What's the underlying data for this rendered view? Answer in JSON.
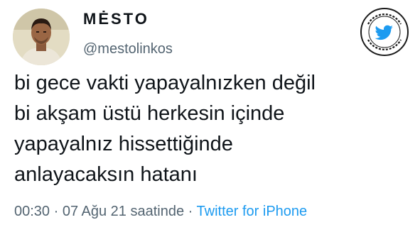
{
  "author": {
    "display_name": "MĖSTO",
    "handle": "@mestolinkos"
  },
  "badge": {
    "text": "10/10 TWEETLER @ONONTWEETLER",
    "icon": "twitter-bird-icon",
    "color": "#1d9bf0"
  },
  "tweet": {
    "lines": [
      "bi gece vakti yapayalnızken değil",
      "bi akşam üstü herkesin içinde",
      "yapayalnız hissettiğinde",
      "anlayacaksın hatanı"
    ]
  },
  "meta": {
    "time": "00:30",
    "separator1": " · ",
    "date": "07 Ağu 21 saatinde",
    "separator2": " · ",
    "source": "Twitter for iPhone"
  },
  "colors": {
    "text": "#0f1419",
    "secondary": "#536471",
    "accent": "#1d9bf0"
  }
}
